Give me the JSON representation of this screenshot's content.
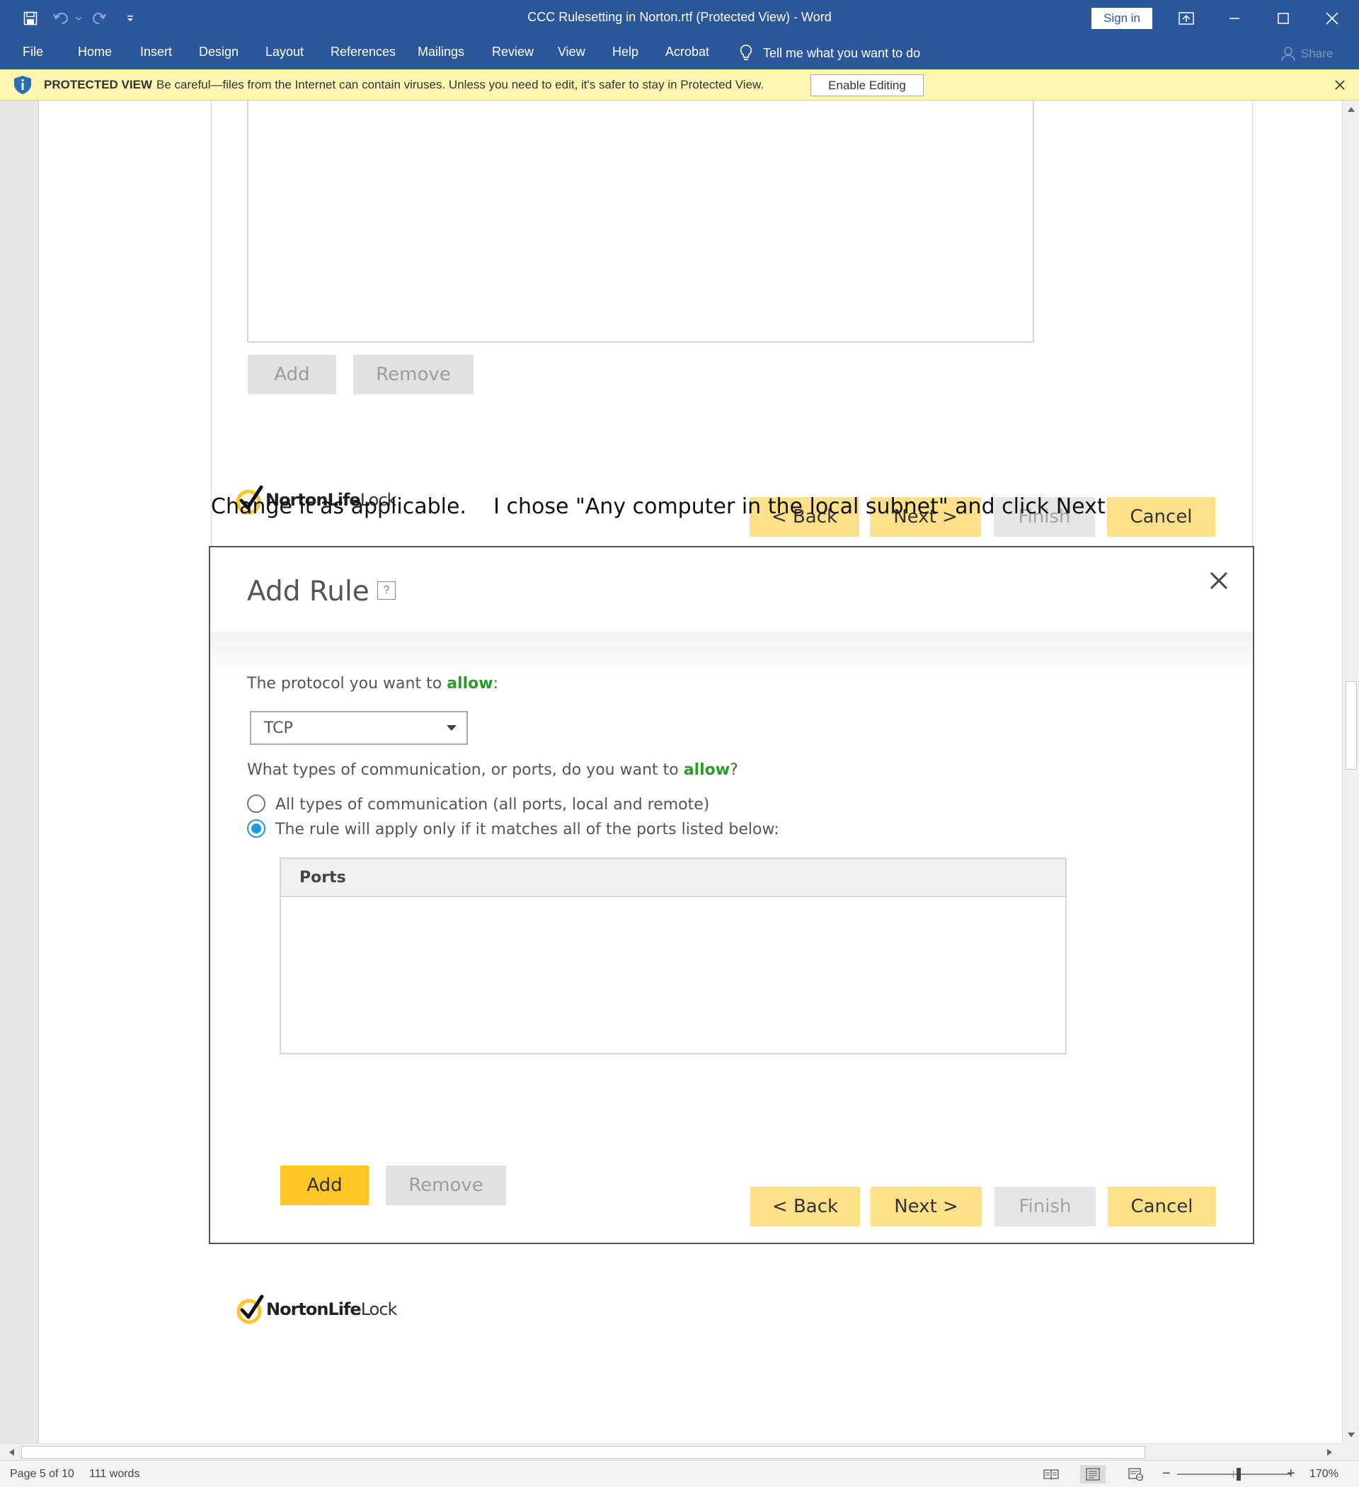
{
  "window": {
    "title": "CCC Rulesetting in Norton.rtf (Protected View)  -  Word",
    "sign_in": "Sign in"
  },
  "ribbon": {
    "tabs": [
      "File",
      "Home",
      "Insert",
      "Design",
      "Layout",
      "References",
      "Mailings",
      "Review",
      "View",
      "Help",
      "Acrobat"
    ],
    "tell_me": "Tell me what you want to do",
    "share": "Share"
  },
  "protected_view": {
    "label": "PROTECTED VIEW",
    "message": "Be careful—files from the Internet can contain viruses. Unless you need to edit, it's safer to stay in Protected View.",
    "enable_button": "Enable Editing"
  },
  "document": {
    "dialog_top": {
      "add_button": "Add",
      "remove_button": "Remove",
      "back_button": "< Back",
      "next_button": "Next >",
      "finish_button": "Finish",
      "cancel_button": "Cancel",
      "logo": {
        "norton": "Norton",
        "life": "Life",
        "lock": "Lock"
      }
    },
    "instruction": "Change it as applicable.    I chose \"Any computer in the local subnet\" and click Next",
    "dialog_add_rule": {
      "title": "Add Rule",
      "help": "?",
      "protocol_prompt_prefix": "The protocol you want to ",
      "protocol_prompt_allow": "allow",
      "protocol_prompt_suffix": ":",
      "protocol_value": "TCP",
      "ports_prompt_prefix": "What types of communication, or ports, do you want to ",
      "ports_prompt_allow": "allow",
      "ports_prompt_suffix": "?",
      "option_all": "All types of communication (all ports, local and remote)",
      "option_listed": "The rule will apply only if it matches all of the ports listed below:",
      "selected_option": "option_listed",
      "ports_header": "Ports",
      "add_button": "Add",
      "remove_button": "Remove",
      "back_button": "< Back",
      "next_button": "Next >",
      "finish_button": "Finish",
      "cancel_button": "Cancel",
      "logo": {
        "norton": "Norton",
        "life": "Life",
        "lock": "Lock"
      }
    }
  },
  "status": {
    "page": "Page 5 of 10",
    "words": "111 words",
    "zoom": "170%",
    "zoom_minus": "−",
    "zoom_plus": "+"
  },
  "colors": {
    "ribbon": "#2b579a",
    "protected_bar": "#fdf6b3",
    "norton_yellow": "#fec726",
    "allow_green": "#2a9a2a",
    "radio_blue": "#1e9be0"
  }
}
